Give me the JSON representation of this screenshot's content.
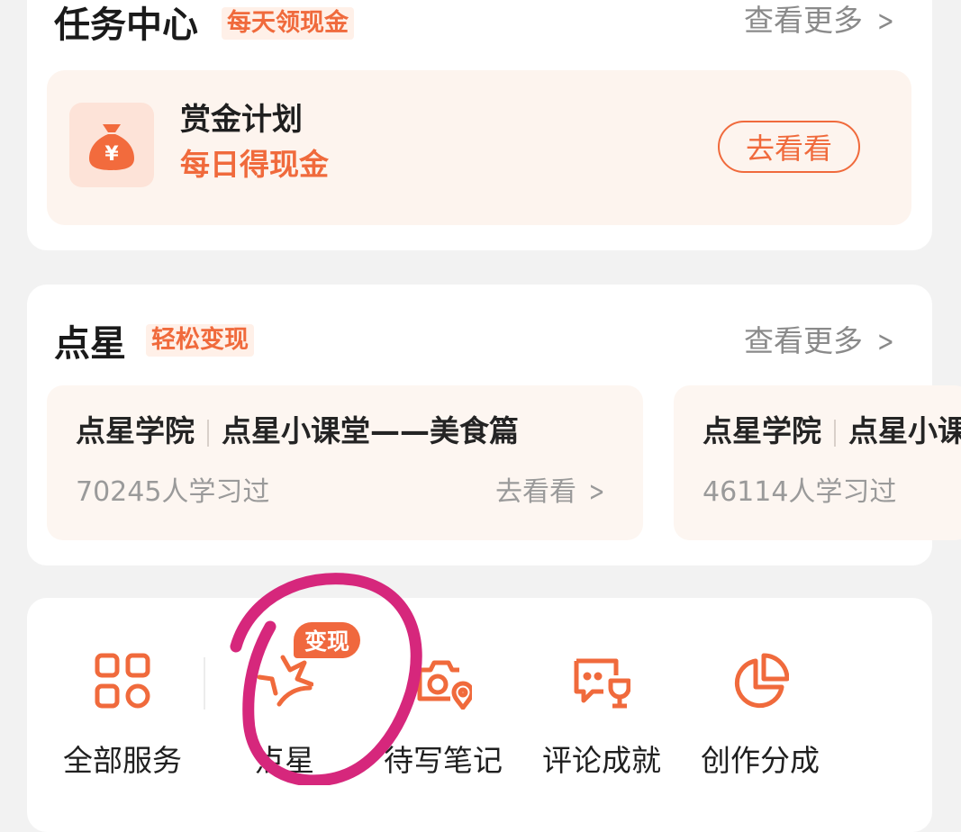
{
  "task_center": {
    "title": "任务中心",
    "tag": "每天领现金",
    "more": "查看更多",
    "bounty": {
      "title": "赏金计划",
      "subtitle": "每日得现金",
      "button": "去看看",
      "icon": "money-bag-icon",
      "icon_symbol": "¥"
    }
  },
  "star": {
    "title": "点星",
    "tag": "轻松变现",
    "more": "查看更多",
    "courses": [
      {
        "source": "点星学院",
        "name": "点星小课堂——美食篇",
        "count": "70245人学习过",
        "go": "去看看"
      },
      {
        "source": "点星学院",
        "name": "点星小课堂",
        "count": "46114人学习过"
      }
    ]
  },
  "services": {
    "items": [
      {
        "label": "全部服务",
        "icon": "grid-icon"
      },
      {
        "label": "点星",
        "icon": "star-icon",
        "badge": "变现"
      },
      {
        "label": "待写笔记",
        "icon": "camera-location-icon"
      },
      {
        "label": "评论成就",
        "icon": "chat-trophy-icon"
      },
      {
        "label": "创作分成",
        "icon": "pie-chart-icon"
      }
    ]
  },
  "colors": {
    "accent": "#f06a3c",
    "circle_annotation": "#d6277c",
    "background": "#f2f2f2"
  }
}
